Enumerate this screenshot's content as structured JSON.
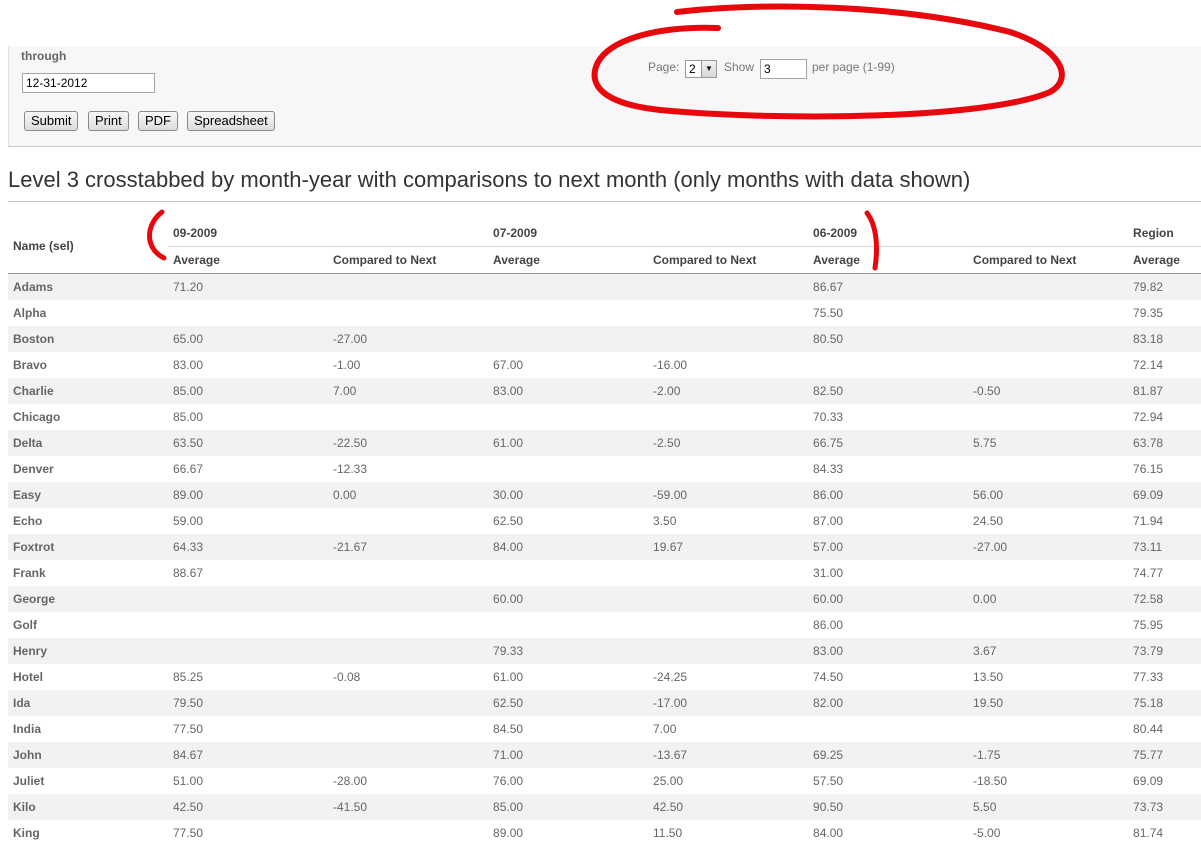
{
  "filters": {
    "through_label": "through",
    "through_value": "12-31-2012",
    "buttons": [
      "Submit",
      "Print",
      "PDF",
      "Spreadsheet"
    ]
  },
  "pager": {
    "page_label": "Page:",
    "page_value": "2",
    "show_label": "Show",
    "show_value": "3",
    "per_page_label": "per page (1-99)"
  },
  "report": {
    "title": "Level 3 crosstabbed by month-year with comparisons to next month (only months with data shown)",
    "name_header": "Name (sel)",
    "groups": [
      "09-2009",
      "07-2009",
      "06-2009",
      "Region"
    ],
    "subheaders": [
      "Average",
      "Compared to Next",
      "Average",
      "Compared to Next",
      "Average",
      "Compared to Next",
      "Average"
    ],
    "rows": [
      {
        "name": "Adams",
        "cells": [
          "71.20",
          "",
          "",
          "",
          "86.67",
          "",
          "79.82"
        ]
      },
      {
        "name": "Alpha",
        "cells": [
          "",
          "",
          "",
          "",
          "75.50",
          "",
          "79.35"
        ]
      },
      {
        "name": "Boston",
        "cells": [
          "65.00",
          "-27.00",
          "",
          "",
          "80.50",
          "",
          "83.18"
        ]
      },
      {
        "name": "Bravo",
        "cells": [
          "83.00",
          "-1.00",
          "67.00",
          "-16.00",
          "",
          "",
          "72.14"
        ]
      },
      {
        "name": "Charlie",
        "cells": [
          "85.00",
          "7.00",
          "83.00",
          "-2.00",
          "82.50",
          "-0.50",
          "81.87"
        ]
      },
      {
        "name": "Chicago",
        "cells": [
          "85.00",
          "",
          "",
          "",
          "70.33",
          "",
          "72.94"
        ]
      },
      {
        "name": "Delta",
        "cells": [
          "63.50",
          "-22.50",
          "61.00",
          "-2.50",
          "66.75",
          "5.75",
          "63.78"
        ]
      },
      {
        "name": "Denver",
        "cells": [
          "66.67",
          "-12.33",
          "",
          "",
          "84.33",
          "",
          "76.15"
        ]
      },
      {
        "name": "Easy",
        "cells": [
          "89.00",
          "0.00",
          "30.00",
          "-59.00",
          "86.00",
          "56.00",
          "69.09"
        ]
      },
      {
        "name": "Echo",
        "cells": [
          "59.00",
          "",
          "62.50",
          "3.50",
          "87.00",
          "24.50",
          "71.94"
        ]
      },
      {
        "name": "Foxtrot",
        "cells": [
          "64.33",
          "-21.67",
          "84.00",
          "19.67",
          "57.00",
          "-27.00",
          "73.11"
        ]
      },
      {
        "name": "Frank",
        "cells": [
          "88.67",
          "",
          "",
          "",
          "31.00",
          "",
          "74.77"
        ]
      },
      {
        "name": "George",
        "cells": [
          "",
          "",
          "60.00",
          "",
          "60.00",
          "0.00",
          "72.58"
        ]
      },
      {
        "name": "Golf",
        "cells": [
          "",
          "",
          "",
          "",
          "86.00",
          "",
          "75.95"
        ]
      },
      {
        "name": "Henry",
        "cells": [
          "",
          "",
          "79.33",
          "",
          "83.00",
          "3.67",
          "73.79"
        ]
      },
      {
        "name": "Hotel",
        "cells": [
          "85.25",
          "-0.08",
          "61.00",
          "-24.25",
          "74.50",
          "13.50",
          "77.33"
        ]
      },
      {
        "name": "Ida",
        "cells": [
          "79.50",
          "",
          "62.50",
          "-17.00",
          "82.00",
          "19.50",
          "75.18"
        ]
      },
      {
        "name": "India",
        "cells": [
          "77.50",
          "",
          "84.50",
          "7.00",
          "",
          "",
          "80.44"
        ]
      },
      {
        "name": "John",
        "cells": [
          "84.67",
          "",
          "71.00",
          "-13.67",
          "69.25",
          "-1.75",
          "75.77"
        ]
      },
      {
        "name": "Juliet",
        "cells": [
          "51.00",
          "-28.00",
          "76.00",
          "25.00",
          "57.50",
          "-18.50",
          "69.09"
        ]
      },
      {
        "name": "Kilo",
        "cells": [
          "42.50",
          "-41.50",
          "85.00",
          "42.50",
          "90.50",
          "5.50",
          "73.73"
        ]
      },
      {
        "name": "King",
        "cells": [
          "77.50",
          "",
          "89.00",
          "11.50",
          "84.00",
          "-5.00",
          "81.74"
        ]
      }
    ]
  },
  "colors": {
    "annotation": "#e8070c",
    "row_stripe": "#f2f2f2"
  }
}
